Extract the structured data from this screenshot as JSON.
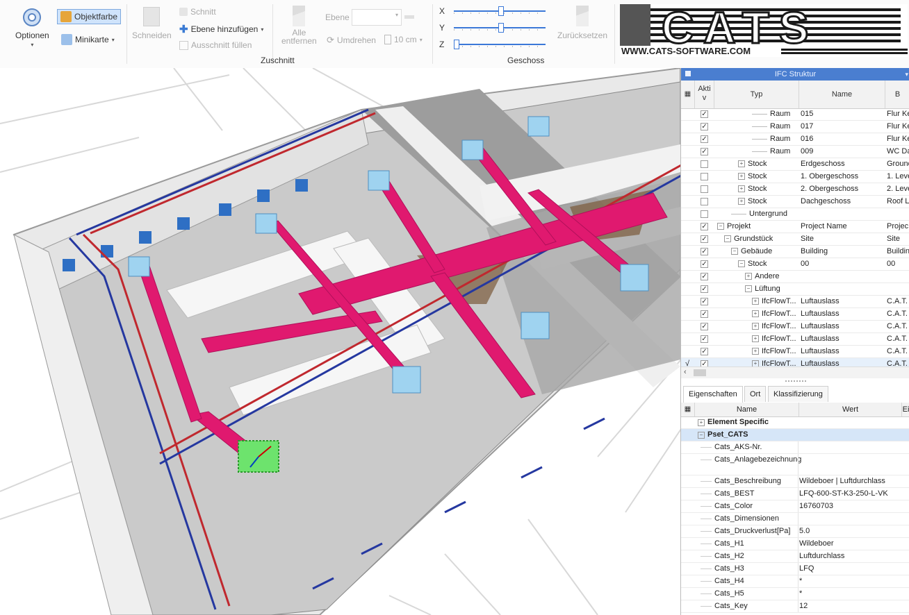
{
  "ribbon": {
    "optionen": "Optionen",
    "objektfarbe": "Objektfarbe",
    "minikarte": "Minikarte",
    "schneiden": "Schneiden",
    "schnitt": "Schnitt",
    "ebene_hinzufuegen": "Ebene hinzufügen",
    "ausschnitt_fuellen": "Ausschnitt füllen",
    "alle_entfernen_1": "Alle",
    "alle_entfernen_2": "entfernen",
    "ebene": "Ebene",
    "umdrehen": "Umdrehen",
    "step": "10 cm",
    "axis_x": "X",
    "axis_y": "Y",
    "axis_z": "Z",
    "zuruecksetzen": "Zurücksetzen",
    "group_zuschnitt": "Zuschnitt",
    "group_geschoss": "Geschoss"
  },
  "logo": {
    "text": "CATS",
    "url": "WWW.CATS-SOFTWARE.COM"
  },
  "ifc": {
    "title": "IFC Struktur",
    "columns": [
      "Aktiv",
      "Typ",
      "Name",
      "B"
    ],
    "col_aktiv_1": "Akti",
    "col_aktiv_2": "v",
    "rows": [
      {
        "typ": "Raum",
        "name": "015",
        "b": "Flur Ke",
        "checked": true,
        "indent": 5,
        "exp": ""
      },
      {
        "typ": "Raum",
        "name": "017",
        "b": "Flur Ke",
        "checked": true,
        "indent": 5,
        "exp": ""
      },
      {
        "typ": "Raum",
        "name": "016",
        "b": "Flur Ke",
        "checked": true,
        "indent": 5,
        "exp": ""
      },
      {
        "typ": "Raum",
        "name": "009",
        "b": "WC Da",
        "checked": true,
        "indent": 5,
        "exp": ""
      },
      {
        "typ": "Stock",
        "name": "Erdgeschoss",
        "b": "Ground",
        "checked": false,
        "indent": 3,
        "exp": "+"
      },
      {
        "typ": "Stock",
        "name": "1. Obergeschoss",
        "b": "1. Leve",
        "checked": false,
        "indent": 3,
        "exp": "+"
      },
      {
        "typ": "Stock",
        "name": "2. Obergeschoss",
        "b": "2. Leve",
        "checked": false,
        "indent": 3,
        "exp": "+"
      },
      {
        "typ": "Stock",
        "name": "Dachgeschoss",
        "b": "Roof L",
        "checked": false,
        "indent": 3,
        "exp": "+"
      },
      {
        "typ": "Untergrund",
        "name": "",
        "b": "",
        "checked": false,
        "indent": 2,
        "exp": ""
      },
      {
        "typ": "Projekt",
        "name": "Project Name",
        "b": "Projec",
        "checked": true,
        "indent": 0,
        "exp": "−"
      },
      {
        "typ": "Grundstück",
        "name": "Site",
        "b": "Site",
        "checked": true,
        "indent": 1,
        "exp": "−"
      },
      {
        "typ": "Gebäude",
        "name": "Building",
        "b": "Buildin",
        "checked": true,
        "indent": 2,
        "exp": "−"
      },
      {
        "typ": "Stock",
        "name": "00",
        "b": "00",
        "checked": true,
        "indent": 3,
        "exp": "−"
      },
      {
        "typ": "Andere",
        "name": "",
        "b": "",
        "checked": true,
        "indent": 4,
        "exp": "+"
      },
      {
        "typ": "Lüftung",
        "name": "",
        "b": "",
        "checked": true,
        "indent": 4,
        "exp": "−"
      },
      {
        "typ": "IfcFlowT...",
        "name": "Luftauslass",
        "b": "C.A.T.",
        "checked": true,
        "indent": 5,
        "exp": "+"
      },
      {
        "typ": "IfcFlowT...",
        "name": "Luftauslass",
        "b": "C.A.T.",
        "checked": true,
        "indent": 5,
        "exp": "+"
      },
      {
        "typ": "IfcFlowT...",
        "name": "Luftauslass",
        "b": "C.A.T.",
        "checked": true,
        "indent": 5,
        "exp": "+"
      },
      {
        "typ": "IfcFlowT...",
        "name": "Luftauslass",
        "b": "C.A.T.",
        "checked": true,
        "indent": 5,
        "exp": "+"
      },
      {
        "typ": "IfcFlowT...",
        "name": "Luftauslass",
        "b": "C.A.T.",
        "checked": true,
        "indent": 5,
        "exp": "+"
      },
      {
        "typ": "IfcFlowT...",
        "name": "Luftauslass",
        "b": "C.A.T.",
        "checked": true,
        "indent": 5,
        "exp": "+",
        "selected": true
      }
    ]
  },
  "props": {
    "tabs": [
      "Eigenschaften",
      "Ort",
      "Klassifizierung"
    ],
    "columns": [
      "Name",
      "Wert",
      "Ei"
    ],
    "rows": [
      {
        "name": "Element Specific",
        "value": "",
        "category": true,
        "exp": "+",
        "h": 18
      },
      {
        "name": "Pset_CATS",
        "value": "",
        "category": true,
        "exp": "−",
        "h": 18,
        "hl": true
      },
      {
        "name": "Cats_AKS-Nr.",
        "value": "",
        "h": 18
      },
      {
        "name": "Cats_Anlagebezeichnung",
        "value": "",
        "h": 31
      },
      {
        "name": "Cats_Beschreibung",
        "value": "Wildeboer | Luftdurchlass",
        "h": 18
      },
      {
        "name": "Cats_BEST",
        "value": "LFQ-600-ST-K3-250-L-VK",
        "h": 18
      },
      {
        "name": "Cats_Color",
        "value": "16760703",
        "h": 18
      },
      {
        "name": "Cats_Dimensionen",
        "value": "",
        "h": 18
      },
      {
        "name": "Cats_Druckverlust[Pa]",
        "value": "5.0",
        "h": 18
      },
      {
        "name": "Cats_H1",
        "value": "Wildeboer",
        "h": 18
      },
      {
        "name": "Cats_H2",
        "value": "Luftdurchlass",
        "h": 18
      },
      {
        "name": "Cats_H3",
        "value": "LFQ",
        "h": 18
      },
      {
        "name": "Cats_H4",
        "value": "*",
        "h": 18
      },
      {
        "name": "Cats_H5",
        "value": "*",
        "h": 18
      },
      {
        "name": "Cats_Key",
        "value": "12",
        "h": 18
      }
    ]
  },
  "colors": {
    "duct": "#e0196f",
    "pipe_red": "#c0282e",
    "pipe_blue": "#2538a0",
    "outlet": "#9fd3f0",
    "accent": "#4a7ed0"
  }
}
